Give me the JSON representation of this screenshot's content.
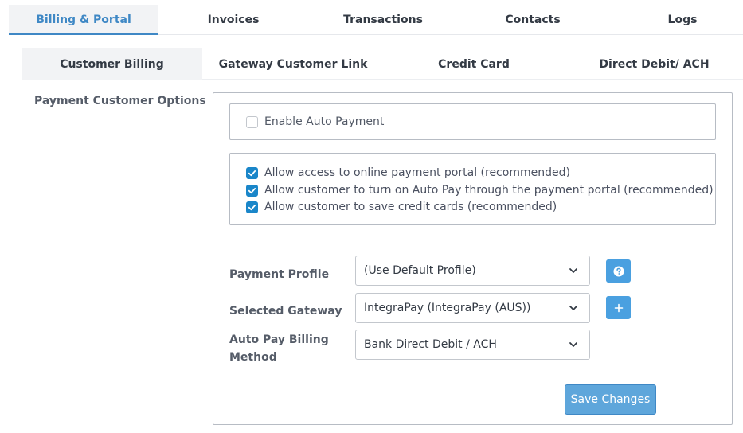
{
  "top_tabs": [
    {
      "label": "Billing & Portal"
    },
    {
      "label": "Invoices"
    },
    {
      "label": "Transactions"
    },
    {
      "label": "Contacts"
    },
    {
      "label": "Logs"
    }
  ],
  "sub_tabs": [
    {
      "label": "Customer Billing"
    },
    {
      "label": "Gateway Customer Link"
    },
    {
      "label": "Credit Card"
    },
    {
      "label": "Direct Debit/ ACH"
    }
  ],
  "section": {
    "label": "Payment Customer Options"
  },
  "auto_payment": {
    "label": "Enable Auto Payment",
    "checked": false
  },
  "portal_options": [
    {
      "label": "Allow access to online payment portal (recommended)",
      "checked": true
    },
    {
      "label": "Allow customer to turn on Auto Pay through the payment portal (recommended)",
      "checked": true
    },
    {
      "label": "Allow customer to save credit cards (recommended)",
      "checked": true
    }
  ],
  "form": {
    "payment_profile": {
      "label": "Payment Profile",
      "value": "(Use Default Profile)"
    },
    "selected_gateway": {
      "label": "Selected Gateway",
      "value": "IntegraPay (IntegraPay (AUS))"
    },
    "auto_pay_method": {
      "label_line1": "Auto Pay Billing",
      "label_line2": "Method",
      "value": "Bank Direct Debit / ACH"
    }
  },
  "buttons": {
    "save": "Save Changes"
  },
  "icons": {
    "help": "question-circle-icon",
    "add": "plus-icon",
    "dropdown": "chevron-down-icon",
    "check": "check-icon"
  },
  "colors": {
    "accent": "#3f88c5",
    "checkbox": "#1a86c9",
    "icon_button": "#4aa0e0",
    "save_button": "#5ea6db"
  }
}
